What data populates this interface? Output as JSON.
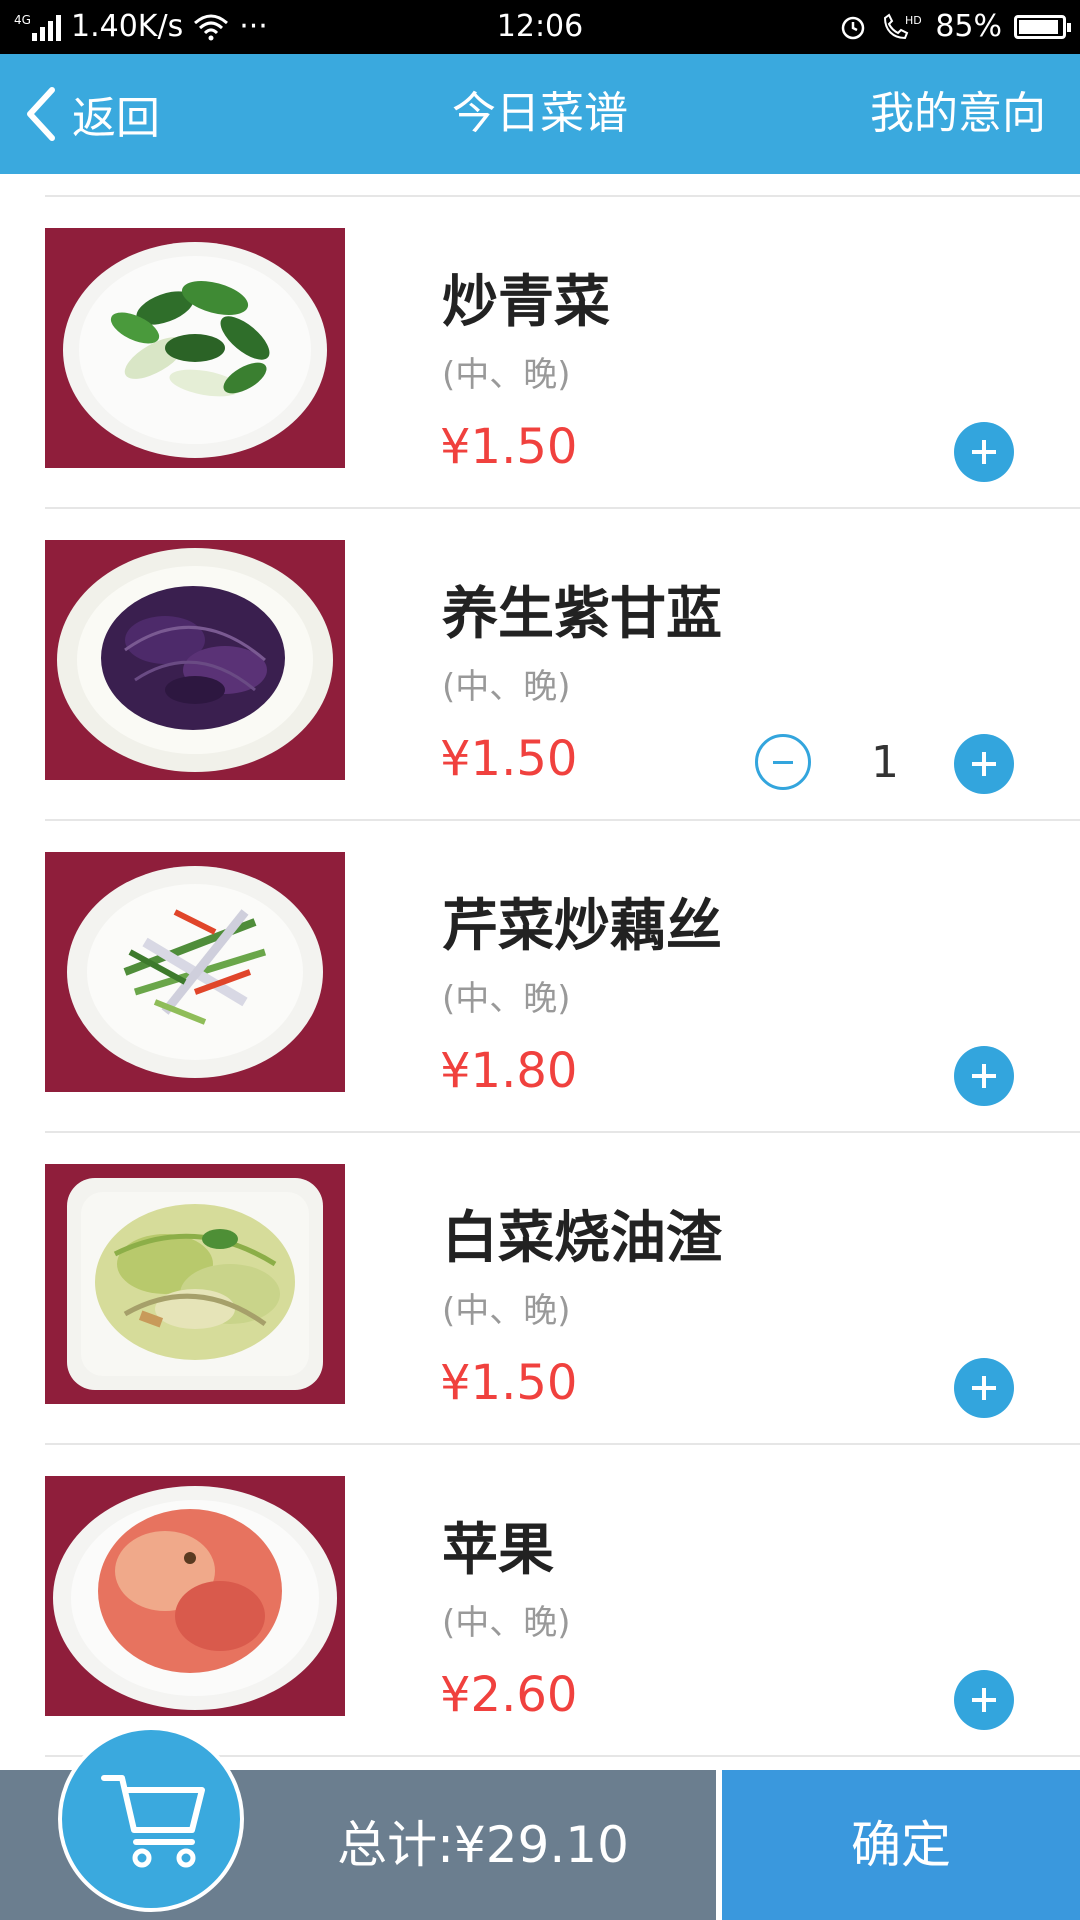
{
  "status_bar": {
    "network_type": "4G",
    "speed": "1.40K/s",
    "dots": "···",
    "time": "12:06",
    "battery": "85%",
    "battery_level": 0.85
  },
  "navbar": {
    "back_label": "返回",
    "title": "今日菜谱",
    "right_label": "我的意向"
  },
  "menu": {
    "items": [
      {
        "name": "炒青菜",
        "meal": "(中、晚)",
        "price": "¥1.50",
        "quantity": "",
        "image": "dish-greens"
      },
      {
        "name": "养生紫甘蓝",
        "meal": "(中、晚)",
        "price": "¥1.50",
        "quantity": "1",
        "image": "dish-purple-cabbage"
      },
      {
        "name": "芹菜炒藕丝",
        "meal": "(中、晚)",
        "price": "¥1.80",
        "quantity": "",
        "image": "dish-celery-lotus"
      },
      {
        "name": "白菜烧油渣",
        "meal": "(中、晚)",
        "price": "¥1.50",
        "quantity": "",
        "image": "dish-cabbage"
      },
      {
        "name": "苹果",
        "meal": "(中、晚)",
        "price": "¥2.60",
        "quantity": "",
        "image": "apple"
      }
    ]
  },
  "bottom_bar": {
    "total": "总计:¥29.10",
    "confirm_label": "确定"
  },
  "colors": {
    "accent": "#3aa9de",
    "price": "#f0413e",
    "bottom": "#6b7e8f",
    "confirm": "#3a98dd"
  }
}
